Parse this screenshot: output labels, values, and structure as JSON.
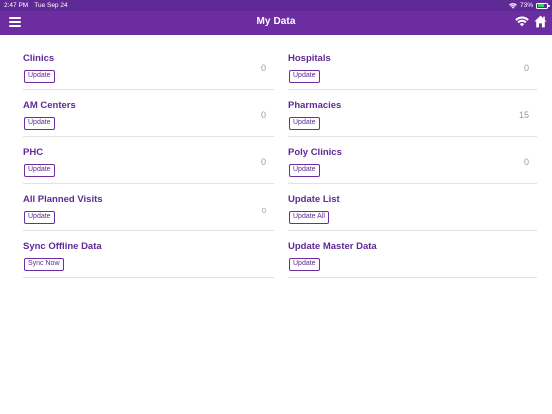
{
  "status_bar": {
    "time": "2:47 PM",
    "date": "Tue Sep 24",
    "battery_percent": "73%",
    "battery_level": 0.73
  },
  "nav": {
    "title": "My Data",
    "menu_icon": "hamburger-menu-icon",
    "wifi_icon": "wifi-icon",
    "home_icon": "home-icon",
    "bar_color": "#6b2da0"
  },
  "items": [
    {
      "name": "Clinics",
      "button": "Update",
      "count": "0"
    },
    {
      "name": "Hospitals",
      "button": "Update",
      "count": "0"
    },
    {
      "name": "AM Centers",
      "button": "Update",
      "count": "0"
    },
    {
      "name": "Pharmacies",
      "button": "Update",
      "count": "15"
    },
    {
      "name": "PHC",
      "button": "Update",
      "count": "0"
    },
    {
      "name": "Poly Clinics",
      "button": "Update",
      "count": "0"
    },
    {
      "name": "All Planned Visits",
      "button": "Update",
      "count": "0"
    },
    {
      "name": "Update List",
      "button": "Update All"
    },
    {
      "name": "Sync Offline Data",
      "button": "Sync Now"
    },
    {
      "name": "Update Master Data",
      "button": "Update"
    }
  ]
}
